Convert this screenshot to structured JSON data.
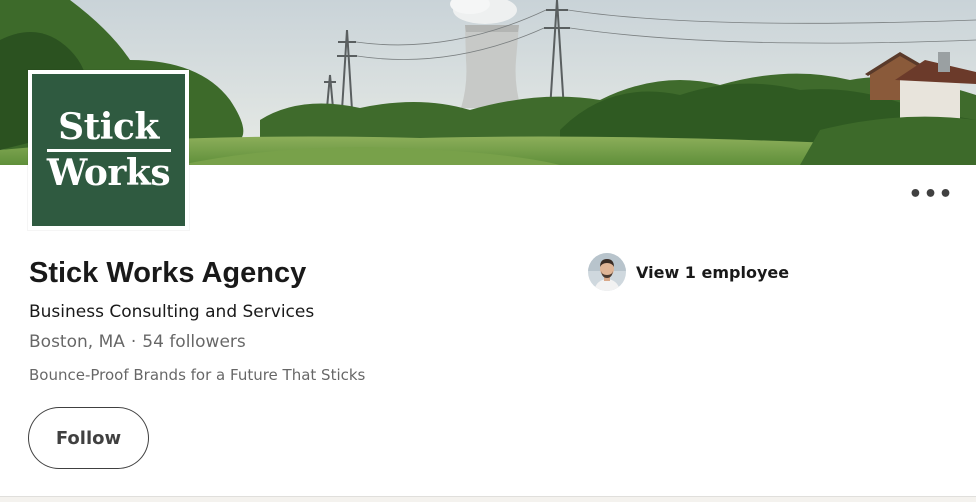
{
  "cover": {
    "scene": "landscape with cooling tower, power pylons, trees and houses"
  },
  "logo": {
    "line1": "Stick",
    "line2": "Works",
    "bg_color": "#2f5a40"
  },
  "overflow_menu": {
    "label": "•••"
  },
  "company": {
    "name": "Stick Works Agency",
    "industry": "Business Consulting and Services",
    "location": "Boston, MA",
    "separator": "·",
    "followers": "54 followers",
    "tagline": "Bounce-Proof Brands for a Future That Sticks"
  },
  "actions": {
    "follow_label": "Follow"
  },
  "employees": {
    "label": "View 1 employee"
  }
}
